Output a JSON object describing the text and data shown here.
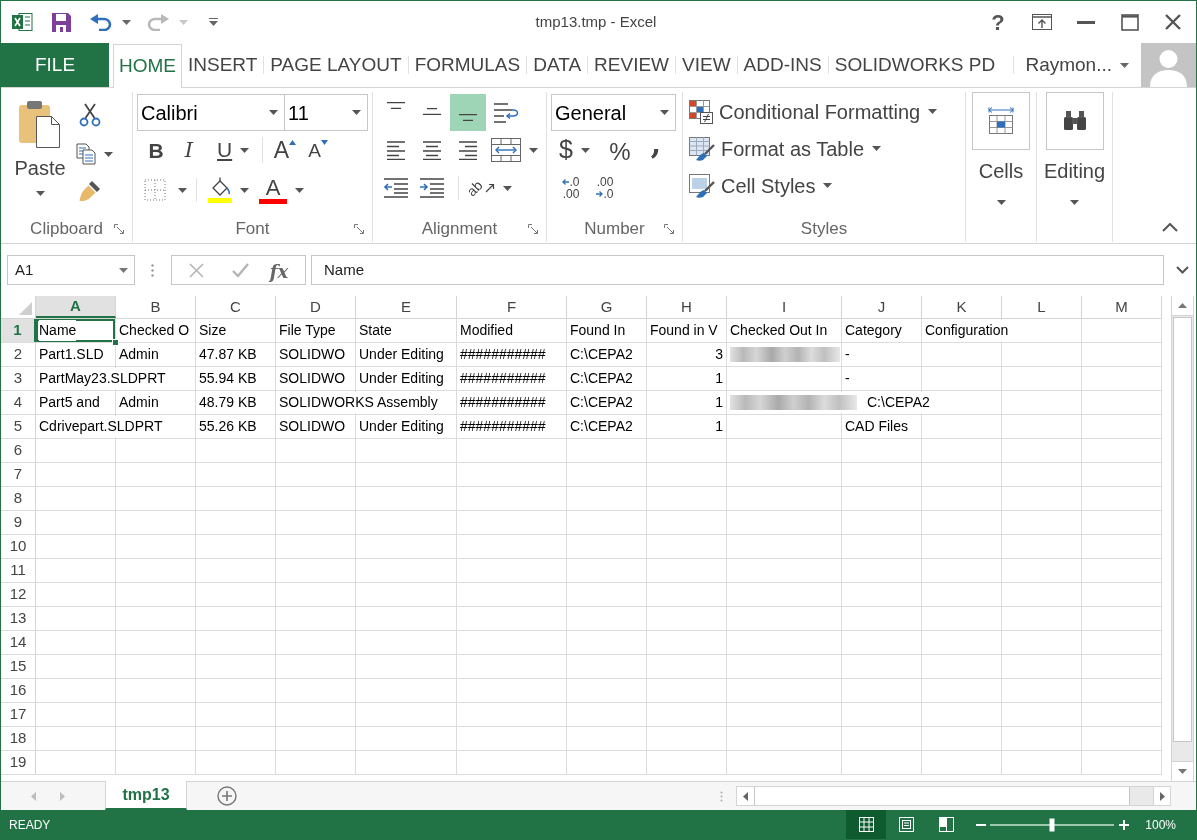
{
  "title_bar": {
    "title": "tmp13.tmp - Excel",
    "help": "?",
    "undo": {
      "disabled": false
    },
    "redo": {
      "disabled": true
    }
  },
  "ribbon_tabs": [
    {
      "label": "FILE",
      "kind": "file",
      "selected": false
    },
    {
      "label": "HOME",
      "kind": "tab",
      "selected": true
    },
    {
      "label": "INSERT",
      "kind": "tab",
      "selected": false
    },
    {
      "label": "PAGE LAYOUT",
      "kind": "tab",
      "selected": false
    },
    {
      "label": "FORMULAS",
      "kind": "tab",
      "selected": false
    },
    {
      "label": "DATA",
      "kind": "tab",
      "selected": false
    },
    {
      "label": "REVIEW",
      "kind": "tab",
      "selected": false
    },
    {
      "label": "VIEW",
      "kind": "tab",
      "selected": false
    },
    {
      "label": "ADD-INS",
      "kind": "tab",
      "selected": false
    },
    {
      "label": "SOLIDWORKS PD",
      "kind": "tab",
      "selected": false
    }
  ],
  "account": {
    "name": "Raymon..."
  },
  "ribbon": {
    "clipboard": {
      "label": "Clipboard",
      "paste": "Paste"
    },
    "font": {
      "label": "Font",
      "font_name": "Calibri",
      "font_size": "11",
      "bold": "B",
      "italic": "I",
      "underline": "U",
      "grow": "A",
      "shrink": "A",
      "font_color": "A"
    },
    "alignment": {
      "label": "Alignment",
      "vertical": [
        {
          "kind": "top",
          "selected": false
        },
        {
          "kind": "middle",
          "selected": false
        },
        {
          "kind": "bottom",
          "selected": true
        }
      ],
      "orientation": "ab"
    },
    "number": {
      "label": "Number",
      "format": "General",
      "currency": "$",
      "percent": "%",
      "comma": ",",
      "increase_decimal": [
        ".0",
        ".00"
      ],
      "decrease_decimal": [
        ".00",
        ".0"
      ]
    },
    "styles": {
      "label": "Styles",
      "commands": [
        "Conditional Formatting",
        "Format as Table",
        "Cell Styles"
      ]
    },
    "cells": {
      "label": "Cells"
    },
    "editing": {
      "label": "Editing"
    }
  },
  "formula_bar": {
    "name_box": "A1",
    "function_label": "fx",
    "value": "Name"
  },
  "sheet": {
    "columns": [
      {
        "label": "A",
        "selected": true
      },
      {
        "label": "B",
        "selected": false
      },
      {
        "label": "C",
        "selected": false
      },
      {
        "label": "D",
        "selected": false
      },
      {
        "label": "E",
        "selected": false
      },
      {
        "label": "F",
        "selected": false
      },
      {
        "label": "G",
        "selected": false
      },
      {
        "label": "H",
        "selected": false
      },
      {
        "label": "I",
        "selected": false
      },
      {
        "label": "J",
        "selected": false
      },
      {
        "label": "K",
        "selected": false
      },
      {
        "label": "L",
        "selected": false
      },
      {
        "label": "M",
        "selected": false
      }
    ],
    "rows": [
      {
        "number": "1",
        "selected": true,
        "cells": [
          {
            "kind": "text",
            "text": "Name",
            "selected": true
          },
          {
            "kind": "text",
            "text": "Checked O",
            "selected": false
          },
          {
            "kind": "text",
            "text": "Size",
            "selected": false
          },
          {
            "kind": "text",
            "text": "File Type",
            "selected": false
          },
          {
            "kind": "text",
            "text": "State",
            "selected": false
          },
          {
            "kind": "text",
            "text": "Modified",
            "selected": false
          },
          {
            "kind": "text",
            "text": "Found In",
            "selected": false
          },
          {
            "kind": "text",
            "text": "Found in V",
            "selected": false
          },
          {
            "kind": "text",
            "text": "Checked Out In",
            "selected": false
          },
          {
            "kind": "text",
            "text": "Category",
            "selected": false
          },
          {
            "kind": "text",
            "text": "Configuration",
            "selected": false
          }
        ]
      },
      {
        "number": "2",
        "selected": false,
        "cells": [
          {
            "kind": "text",
            "text": "Part1.SLD",
            "selected": false
          },
          {
            "kind": "text",
            "text": "Admin",
            "selected": false
          },
          {
            "kind": "text",
            "text": "47.87 KB",
            "selected": false
          },
          {
            "kind": "text",
            "text": "SOLIDWO",
            "selected": false
          },
          {
            "kind": "text",
            "text": "Under Editing",
            "selected": false
          },
          {
            "kind": "text",
            "text": "###########",
            "selected": false
          },
          {
            "kind": "text",
            "text": "C:\\CEPA2",
            "selected": false
          },
          {
            "kind": "number",
            "text": "3",
            "selected": false
          },
          {
            "kind": "redacted",
            "selected": false
          },
          {
            "kind": "text",
            "text": "-",
            "selected": false
          }
        ]
      },
      {
        "number": "3",
        "selected": false,
        "cells": [
          {
            "kind": "text",
            "text": "PartMay23.SLDPRT",
            "selected": false
          },
          null,
          {
            "kind": "text",
            "text": "55.94 KB",
            "selected": false
          },
          {
            "kind": "text",
            "text": "SOLIDWO",
            "selected": false
          },
          {
            "kind": "text",
            "text": "Under Editing",
            "selected": false
          },
          {
            "kind": "text",
            "text": "###########",
            "selected": false
          },
          {
            "kind": "text",
            "text": "C:\\CEPA2",
            "selected": false
          },
          {
            "kind": "number",
            "text": "1",
            "selected": false
          },
          null,
          {
            "kind": "text",
            "text": "-",
            "selected": false
          }
        ]
      },
      {
        "number": "4",
        "selected": false,
        "cells": [
          {
            "kind": "text",
            "text": "Part5 and",
            "selected": false
          },
          {
            "kind": "text",
            "text": "Admin",
            "selected": false
          },
          {
            "kind": "text",
            "text": "48.79 KB",
            "selected": false
          },
          {
            "kind": "text",
            "text": "SOLIDWORKS Assembly",
            "selected": false
          },
          null,
          {
            "kind": "text",
            "text": "###########",
            "selected": false
          },
          {
            "kind": "text",
            "text": "C:\\CEPA2",
            "selected": false
          },
          {
            "kind": "number",
            "text": "1",
            "selected": false
          },
          {
            "kind": "redacted",
            "text": "C:\\CEPA2",
            "selected": false
          }
        ]
      },
      {
        "number": "5",
        "selected": false,
        "cells": [
          {
            "kind": "text",
            "text": "Cdrivepart.SLDPRT",
            "selected": false
          },
          null,
          {
            "kind": "text",
            "text": "55.26 KB",
            "selected": false
          },
          {
            "kind": "text",
            "text": "SOLIDWO",
            "selected": false
          },
          {
            "kind": "text",
            "text": "Under Editing",
            "selected": false
          },
          {
            "kind": "text",
            "text": "###########",
            "selected": false
          },
          {
            "kind": "text",
            "text": "C:\\CEPA2",
            "selected": false
          },
          {
            "kind": "number",
            "text": "1",
            "selected": false
          },
          null,
          {
            "kind": "text",
            "text": "CAD Files",
            "selected": false
          }
        ]
      },
      {
        "number": "6",
        "selected": false
      },
      {
        "number": "7",
        "selected": false
      },
      {
        "number": "8",
        "selected": false
      },
      {
        "number": "9",
        "selected": false
      },
      {
        "number": "10",
        "selected": false
      },
      {
        "number": "11",
        "selected": false
      },
      {
        "number": "12",
        "selected": false
      },
      {
        "number": "13",
        "selected": false
      },
      {
        "number": "14",
        "selected": false
      },
      {
        "number": "15",
        "selected": false
      },
      {
        "number": "16",
        "selected": false
      },
      {
        "number": "17",
        "selected": false
      },
      {
        "number": "18",
        "selected": false
      },
      {
        "number": "19",
        "selected": false
      }
    ]
  },
  "sheet_tabs": [
    {
      "label": "tmp13",
      "selected": true
    }
  ],
  "status_bar": {
    "status": "READY",
    "views": [
      {
        "kind": "normal",
        "selected": true
      },
      {
        "kind": "page_layout",
        "selected": false
      },
      {
        "kind": "page_break",
        "selected": false
      }
    ],
    "zoom": {
      "level": 0.5,
      "reading": "100%"
    }
  }
}
